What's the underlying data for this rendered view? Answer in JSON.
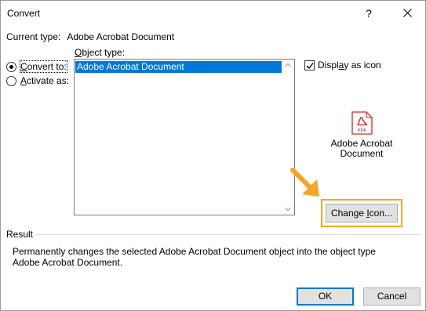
{
  "window": {
    "title": "Convert",
    "help_glyph": "?"
  },
  "current_type": {
    "label": "Current type:",
    "value": "Adobe Acrobat Document"
  },
  "options": {
    "convert_to": {
      "pre": "",
      "accel": "C",
      "post": "onvert to:",
      "checked": true
    },
    "activate_as": {
      "pre": "",
      "accel": "A",
      "post": "ctivate as:",
      "checked": false
    }
  },
  "object_type": {
    "label_accel": "O",
    "label_rest": "bject type:",
    "items": [
      "Adobe Acrobat Document"
    ],
    "selected_index": 0
  },
  "display_as_icon": {
    "pre": "Displ",
    "accel": "a",
    "post": "y as icon",
    "checked": true
  },
  "icon_preview": {
    "icon": "pdf-file-icon",
    "caption_line1": "Adobe Acrobat",
    "caption_line2": "Document",
    "badge": "PDF",
    "accent_color": "#e2231a"
  },
  "change_icon_button": {
    "pre": "Change ",
    "accel": "I",
    "post": "con..."
  },
  "highlight_color": "#f5a623",
  "result": {
    "label": "Result",
    "text": "Permanently changes the selected Adobe Acrobat Document object into the object type Adobe Acrobat Document."
  },
  "buttons": {
    "ok": "OK",
    "cancel": "Cancel"
  }
}
